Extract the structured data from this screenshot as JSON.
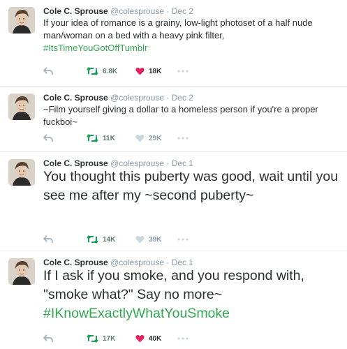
{
  "colors": {
    "hashtag": "#2fa84f",
    "liked_heart": "#e0245e",
    "retweet": "#19a05a",
    "muted": "#8899a6"
  },
  "icons": [
    "reply-icon",
    "retweet-icon",
    "heart-icon",
    "more-icon",
    "avatar"
  ],
  "tweets": [
    {
      "name": "Cole C. Sprouse",
      "handle": "@colesprouse",
      "separator": "·",
      "date": "Dec 2",
      "text": "If your idea of romance is a grainy, low-light photoset of a half nude man/woman on a bed with a heavy pink filter,",
      "hashtag": "#ItsTimeYouGotOffTumblr",
      "retweets": "6.8K",
      "likes": "18K",
      "liked": true
    },
    {
      "name": "Cole C. Sprouse",
      "handle": "@colesprouse",
      "separator": "·",
      "date": "Dec 2",
      "text": "~Film yourself giving a dollar to a homeless person if you're a proper fuckboi~",
      "hashtag": "",
      "retweets": "11K",
      "likes": "29K",
      "liked": false
    },
    {
      "name": "Cole C. Sprouse",
      "handle": "@colesprouse",
      "separator": "·",
      "date": "Dec 1",
      "text": "You thought this puberty was good, wait until you see me after my ~second puberty~",
      "hashtag": "",
      "retweets": "14K",
      "likes": "39K",
      "liked": false
    },
    {
      "name": "Cole C. Sprouse",
      "handle": "@colesprouse",
      "separator": "·",
      "date": "Dec 1",
      "text": "If I ask if you smoke, and you respond with, \"smoke what?\" Say no more~",
      "hashtag": "#IKnowExactlyWhatYouSmoke",
      "retweets": "17K",
      "likes": "40K",
      "liked": true
    }
  ]
}
